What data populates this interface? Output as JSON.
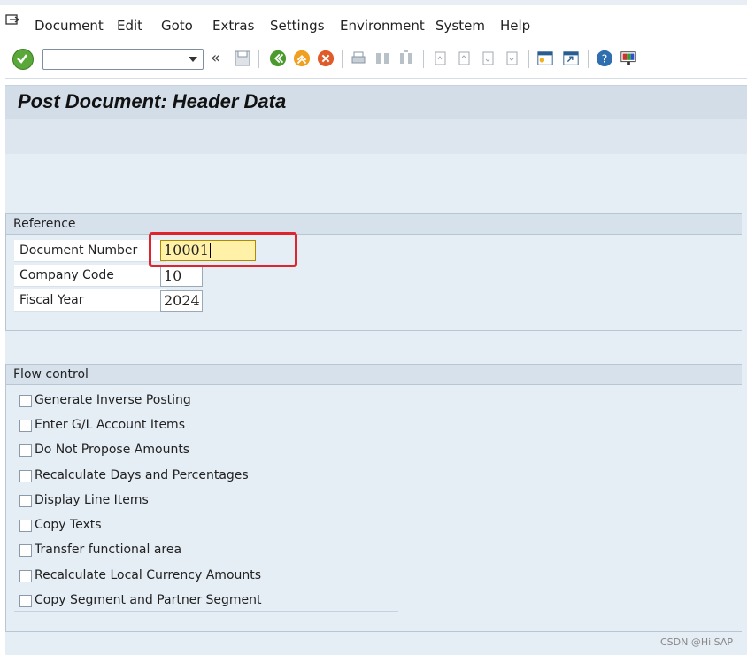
{
  "menu": {
    "items": [
      "Document",
      "Edit",
      "Goto",
      "Extras",
      "Settings",
      "Environment",
      "System",
      "Help"
    ],
    "system_icon": "system-menu-icon"
  },
  "toolbar": {
    "command_field_value": "",
    "icons": [
      "enter-icon",
      "back-history-icon",
      "save-icon",
      "back-icon",
      "exit-icon",
      "cancel-icon",
      "print-icon",
      "find-icon",
      "find-next-icon",
      "first-page-icon",
      "previous-page-icon",
      "next-page-icon",
      "last-page-icon",
      "create-session-icon",
      "shortcut-icon",
      "help-icon",
      "customize-layout-icon"
    ]
  },
  "page": {
    "title": "Post Document: Header Data"
  },
  "reference": {
    "heading": "Reference",
    "fields": [
      {
        "label": "Document Number",
        "value": "10001"
      },
      {
        "label": "Company Code",
        "value": "10"
      },
      {
        "label": "Fiscal Year",
        "value": "2024"
      }
    ]
  },
  "flow_control": {
    "heading": "Flow control",
    "options": [
      {
        "label": "Generate Inverse Posting",
        "checked": false
      },
      {
        "label": "Enter G/L Account Items",
        "checked": false
      },
      {
        "label": "Do Not Propose Amounts",
        "checked": false
      },
      {
        "label": "Recalculate Days and Percentages",
        "checked": false
      },
      {
        "label": "Display Line Items",
        "checked": false
      },
      {
        "label": "Copy Texts",
        "checked": false
      },
      {
        "label": "Transfer functional area",
        "checked": false
      },
      {
        "label": "Recalculate Local Currency Amounts",
        "checked": false
      },
      {
        "label": "Copy Segment and Partner Segment",
        "checked": false
      }
    ]
  },
  "watermark": "CSDN @Hi SAP",
  "colors": {
    "accent_highlight": "#e0242e",
    "active_field": "#fff2a8",
    "background": "#e5edf5"
  }
}
